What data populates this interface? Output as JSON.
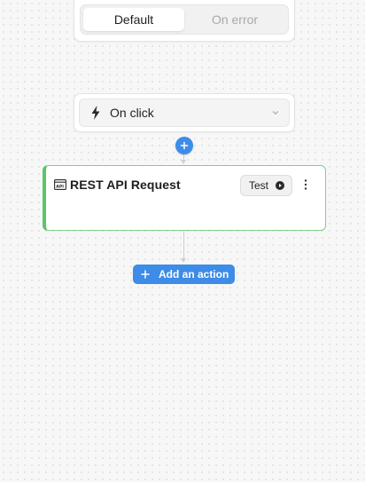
{
  "tabs": {
    "default_label": "Default",
    "on_error_label": "On error",
    "active": "default"
  },
  "trigger": {
    "label": "On click",
    "icon": "bolt-icon"
  },
  "action": {
    "title": "REST API Request",
    "icon": "api-window-icon",
    "test_label": "Test"
  },
  "add_action": {
    "label": "Add an action"
  },
  "colors": {
    "accent": "#3d8ce8",
    "card_border": "#5cc46a"
  }
}
